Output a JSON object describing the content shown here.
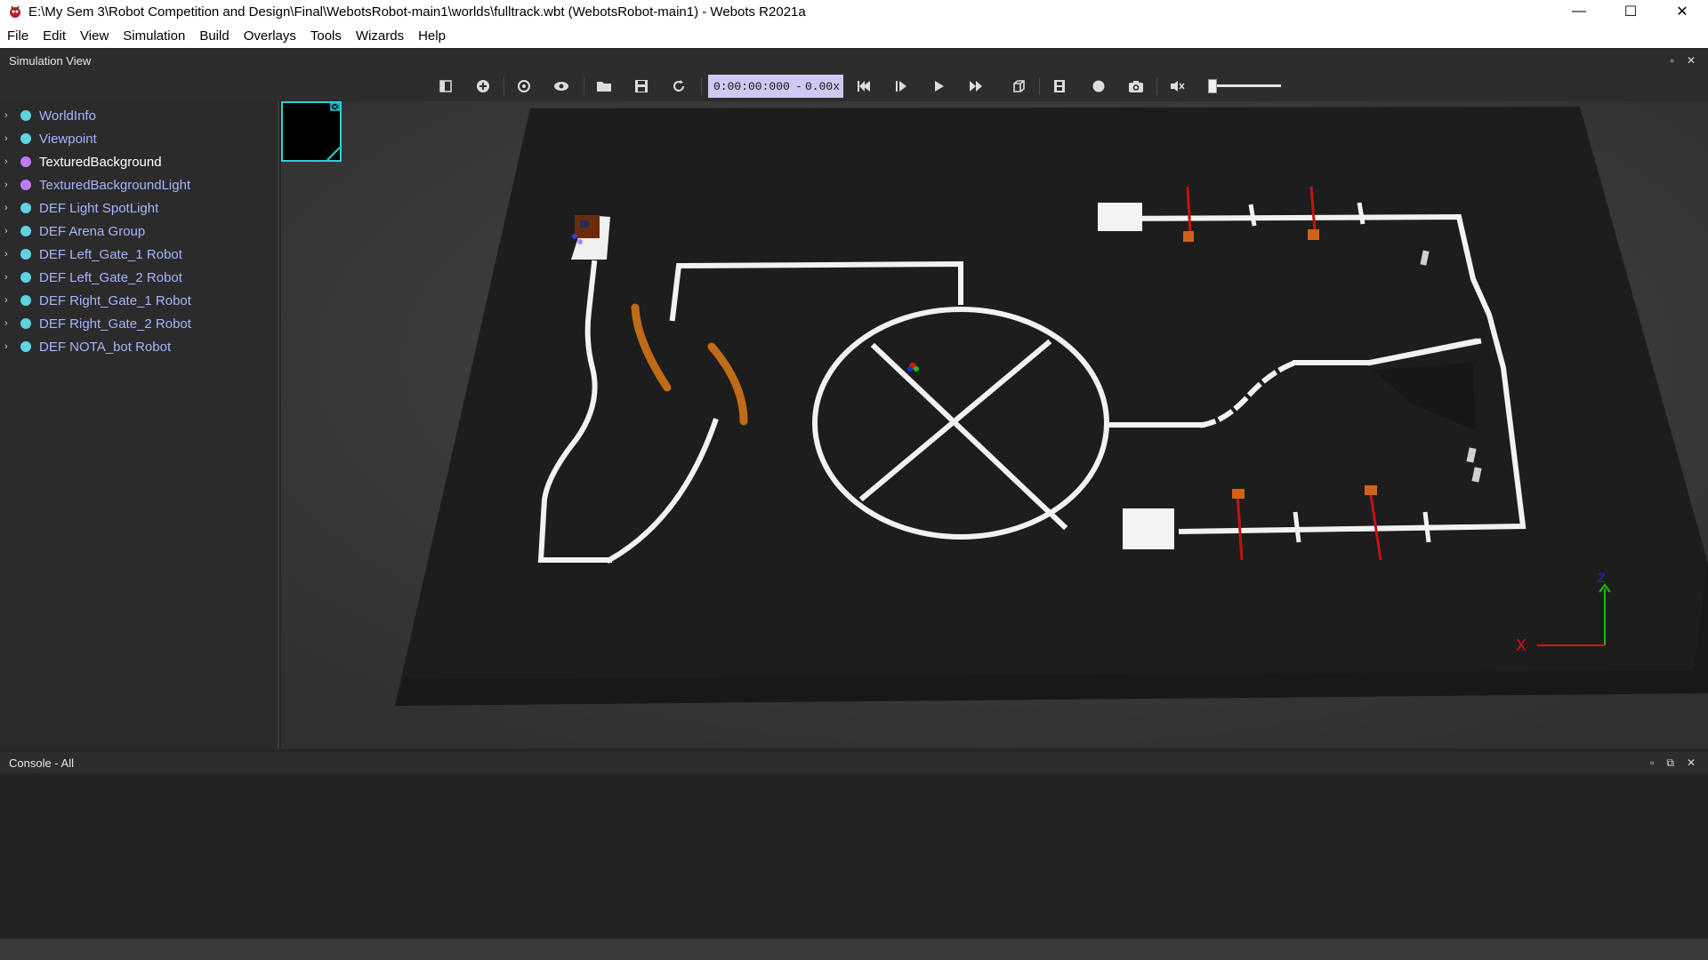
{
  "window": {
    "title": "E:\\My Sem 3\\Robot Competition and Design\\Final\\WebotsRobot-main1\\worlds\\fulltrack.wbt (WebotsRobot-main1) - Webots R2021a",
    "controls": {
      "minimize": "—",
      "maximize": "☐",
      "close": "✕"
    }
  },
  "menu": [
    "File",
    "Edit",
    "View",
    "Simulation",
    "Build",
    "Overlays",
    "Tools",
    "Wizards",
    "Help"
  ],
  "simulation_view": {
    "header": "Simulation View",
    "time": "0:00:00:000",
    "separator": "-",
    "speed": "0.00x"
  },
  "toolbar_icons": [
    "show-scene-tree-icon",
    "add-node-icon",
    "reset-viewpoint-icon",
    "view-icon",
    "open-world-icon",
    "save-world-icon",
    "reload-world-icon",
    "reset-simulation-icon",
    "step-icon",
    "run-realtime-icon",
    "fast-forward-icon",
    "render-toggle-icon",
    "record-movie-icon",
    "record-animation-icon",
    "screenshot-icon",
    "mute-icon"
  ],
  "scene_tree": {
    "items": [
      {
        "label": "WorldInfo",
        "color": "#5ed3e4"
      },
      {
        "label": "Viewpoint",
        "color": "#5ed3e4"
      },
      {
        "label": "TexturedBackground",
        "color": "#c27bf2",
        "selected": true
      },
      {
        "label": "TexturedBackgroundLight",
        "color": "#c27bf2"
      },
      {
        "label": "DEF Light SpotLight",
        "color": "#5ed3e4"
      },
      {
        "label": "DEF Arena Group",
        "color": "#5ed3e4"
      },
      {
        "label": "DEF Left_Gate_1 Robot",
        "color": "#5ed3e4"
      },
      {
        "label": "DEF Left_Gate_2 Robot",
        "color": "#5ed3e4"
      },
      {
        "label": "DEF Right_Gate_1 Robot",
        "color": "#5ed3e4"
      },
      {
        "label": "DEF Right_Gate_2 Robot",
        "color": "#5ed3e4"
      },
      {
        "label": "DEF NOTA_bot Robot",
        "color": "#5ed3e4"
      }
    ]
  },
  "axes": {
    "x_label": "X",
    "z_label": "Z"
  },
  "console": {
    "header": "Console - All"
  }
}
